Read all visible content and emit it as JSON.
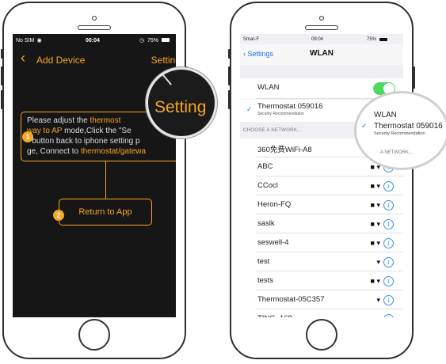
{
  "left": {
    "status": {
      "carrier": "No SIM",
      "time": "00:04",
      "battery": "75%"
    },
    "nav": {
      "back_icon": "chevron-left-icon",
      "title": "Add Device",
      "action": "Setting"
    },
    "instruction": {
      "step": "1",
      "line1a": "Please adjust the ",
      "line1b": "thermost",
      "line2a": "way to ",
      "line2b": "AP",
      "line2c": " mode,Click the \"Se",
      "line3": "\" button back to iphone setting p",
      "line4a": "ge, Connect to ",
      "line4b": "thermostat/gatewa"
    },
    "return": {
      "step": "2",
      "label": "Return to App"
    },
    "magnifier": {
      "label": "Setting"
    }
  },
  "right": {
    "status": {
      "carrier": "Smar-F",
      "time": "09:04",
      "battery": "75%"
    },
    "nav": {
      "back": "Settings",
      "title": "WLAN"
    },
    "wlan": {
      "label": "WLAN",
      "toggle_on": true
    },
    "connected": {
      "name": "Thermostat 059016",
      "sub": "Security Recommendation"
    },
    "section_header": "CHOOSE A NETWORK...",
    "networks": [
      {
        "name": "360免费WiFi-A8",
        "lock": true
      },
      {
        "name": "ABC",
        "lock": true
      },
      {
        "name": "CCocl",
        "lock": true
      },
      {
        "name": "Heron-FQ",
        "lock": true
      },
      {
        "name": "saslk",
        "lock": true
      },
      {
        "name": "seswell-4",
        "lock": true
      },
      {
        "name": "test",
        "lock": false
      },
      {
        "name": "tests",
        "lock": true
      },
      {
        "name": "Thermostat-05C357",
        "lock": false
      },
      {
        "name": "TING_168",
        "lock": true
      }
    ],
    "magnifier": {
      "wlan": "WLAN",
      "name": "Thermostat 059016",
      "sub": "Security Recommendation",
      "header": "A NETWORK..."
    }
  },
  "colors": {
    "accent": "#f5a623",
    "ios_blue": "#1a73e8",
    "toggle": "#4cd964"
  }
}
